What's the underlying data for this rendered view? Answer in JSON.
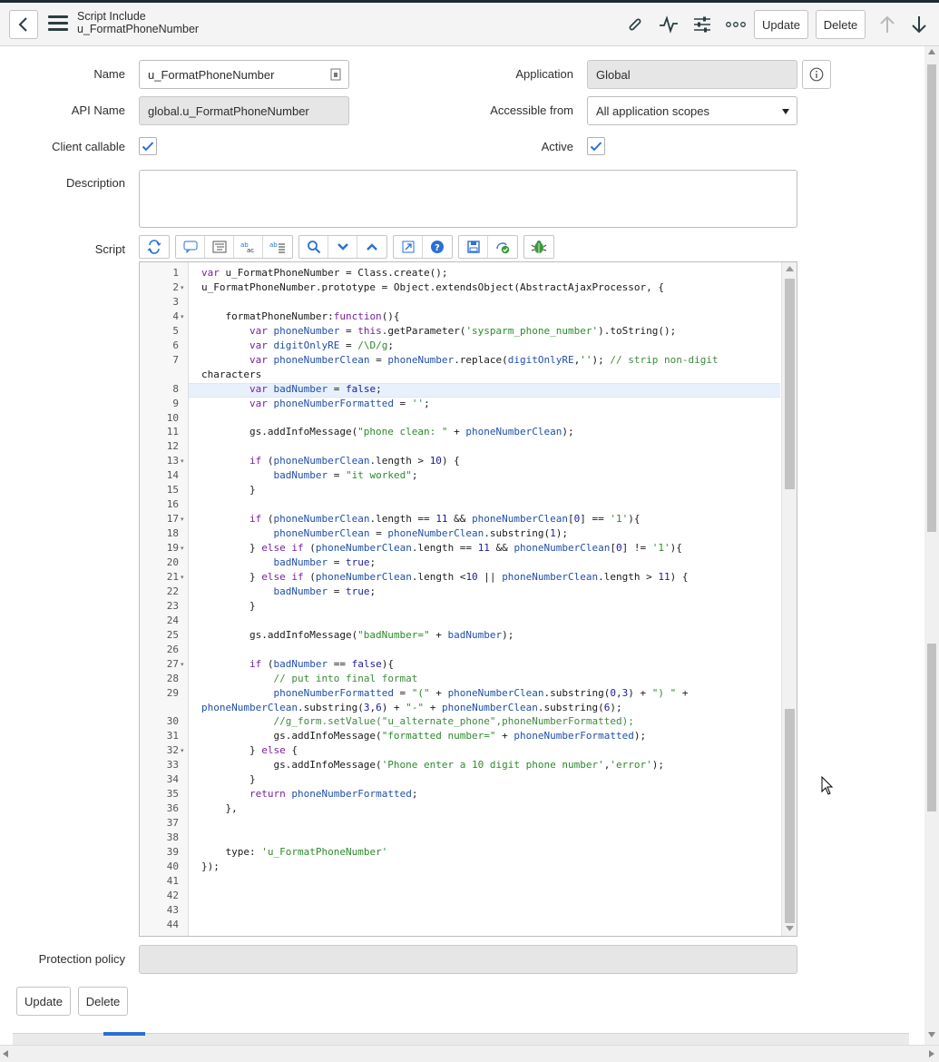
{
  "header": {
    "record_type": "Script Include",
    "record_name": "u_FormatPhoneNumber",
    "update_label": "Update",
    "delete_label": "Delete"
  },
  "form": {
    "name": {
      "label": "Name",
      "value": "u_FormatPhoneNumber"
    },
    "application": {
      "label": "Application",
      "value": "Global"
    },
    "api_name": {
      "label": "API Name",
      "value": "global.u_FormatPhoneNumber"
    },
    "accessible_from": {
      "label": "Accessible from",
      "value": "All application scopes"
    },
    "client_callable": {
      "label": "Client callable",
      "checked": true
    },
    "active": {
      "label": "Active",
      "checked": true
    },
    "description": {
      "label": "Description",
      "value": ""
    },
    "script_label": "Script",
    "protection_policy": {
      "label": "Protection policy",
      "value": ""
    }
  },
  "script": {
    "line_numbers": [
      "1",
      "2",
      "3",
      "4",
      "5",
      "6",
      "7",
      "8",
      "9",
      "10",
      "11",
      "12",
      "13",
      "14",
      "15",
      "16",
      "17",
      "18",
      "19",
      "20",
      "21",
      "22",
      "23",
      "24",
      "25",
      "26",
      "27",
      "28",
      "29",
      "30",
      "31",
      "32",
      "33",
      "34",
      "35",
      "36",
      "37",
      "38",
      "39",
      "40",
      "41",
      "42",
      "43",
      "44"
    ],
    "folds": [
      "2",
      "4",
      "13",
      "17",
      "19",
      "21",
      "27",
      "32"
    ],
    "lines": [
      "var u_FormatPhoneNumber = Class.create();",
      "u_FormatPhoneNumber.prototype = Object.extendsObject(AbstractAjaxProcessor, {",
      "",
      "    formatPhoneNumber:function(){",
      "        var phoneNumber = this.getParameter('sysparm_phone_number').toString();",
      "        var digitOnlyRE = /\\D/g;",
      "        var phoneNumberClean = phoneNumber.replace(digitOnlyRE,''); // strip non-digit",
      "characters",
      "        var badNumber = false;",
      "        var phoneNumberFormatted = '';",
      "",
      "        gs.addInfoMessage(\"phone clean: \" + phoneNumberClean);",
      "",
      "        if (phoneNumberClean.length > 10) {",
      "            badNumber = \"it worked\";",
      "        }",
      "",
      "        if (phoneNumberClean.length == 11 && phoneNumberClean[0] == '1'){",
      "            phoneNumberClean = phoneNumberClean.substring(1);",
      "        } else if (phoneNumberClean.length == 11 && phoneNumberClean[0] != '1'){",
      "            badNumber = true;",
      "        } else if (phoneNumberClean.length <10 || phoneNumberClean.length > 11) {",
      "            badNumber = true;",
      "        }",
      "",
      "        gs.addInfoMessage(\"badNumber=\" + badNumber);",
      "",
      "        if (badNumber == false){",
      "            // put into final format",
      "            phoneNumberFormatted = \"(\" + phoneNumberClean.substring(0,3) + \") \" +",
      "phoneNumberClean.substring(3,6) + \"-\" + phoneNumberClean.substring(6);",
      "            //g_form.setValue(\"u_alternate_phone\",phoneNumberFormatted);",
      "            gs.addInfoMessage(\"formatted number=\" + phoneNumberFormatted);",
      "        } else {",
      "            gs.addInfoMessage('Phone enter a 10 digit phone number','error');",
      "        }",
      "        return phoneNumberFormatted;",
      "    },",
      "",
      "",
      "    type: 'u_FormatPhoneNumber'",
      "});",
      "",
      "",
      "",
      ""
    ]
  },
  "footer": {
    "update_label": "Update",
    "delete_label": "Delete"
  },
  "icons": [
    "back-icon",
    "hamburger-menu-icon",
    "paperclip-icon",
    "activity-icon",
    "settings-sliders-icon",
    "more-icon",
    "arrow-up-icon",
    "arrow-down-icon",
    "info-icon",
    "reference-lookup-icon",
    "checkmark-icon"
  ],
  "colors": {
    "checkmark": "#2a6fd6",
    "header_bg": "#f4f4f4",
    "readonly_bg": "#e6e6e6"
  }
}
